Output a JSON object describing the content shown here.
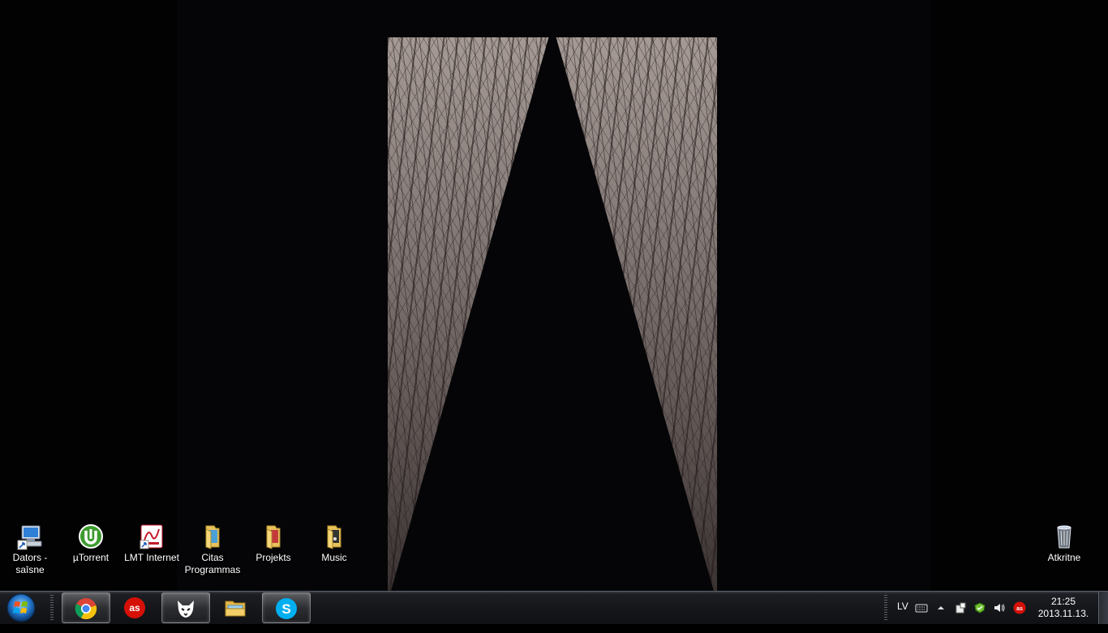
{
  "desktop": {
    "icons": [
      {
        "name": "dators-saisne",
        "line1": "Dators -",
        "line2": "saīsne",
        "icon": "computer-shortcut-icon"
      },
      {
        "name": "utorrent",
        "line1": "µTorrent",
        "line2": "",
        "icon": "utorrent-icon"
      },
      {
        "name": "lmt-internet",
        "line1": "LMT Internet",
        "line2": "",
        "icon": "lmt-internet-icon"
      },
      {
        "name": "citas-programmas",
        "line1": "Citas",
        "line2": "Programmas",
        "icon": "folder-icon"
      },
      {
        "name": "projekts",
        "line1": "Projekts",
        "line2": "",
        "icon": "folder-icon"
      },
      {
        "name": "music",
        "line1": "Music",
        "line2": "",
        "icon": "folder-icon"
      }
    ],
    "recycle_bin": {
      "label": "Atkritne",
      "icon": "recycle-bin-icon"
    }
  },
  "taskbar": {
    "pinned": [
      {
        "name": "chrome",
        "icon": "chrome-icon",
        "active": true
      },
      {
        "name": "lastfm",
        "icon": "lastfm-icon",
        "active": false
      },
      {
        "name": "foobar",
        "icon": "foobar-icon",
        "active": true
      },
      {
        "name": "explorer",
        "icon": "explorer-folder-icon",
        "active": false
      },
      {
        "name": "skype",
        "icon": "skype-icon",
        "active": true
      }
    ],
    "tray": {
      "language": "LV",
      "time": "21:25",
      "date": "2013.11.13."
    }
  },
  "colors": {
    "lastfm_red": "#d51007",
    "utorrent_green": "#3e9b2f",
    "skype_blue": "#00aff0"
  }
}
